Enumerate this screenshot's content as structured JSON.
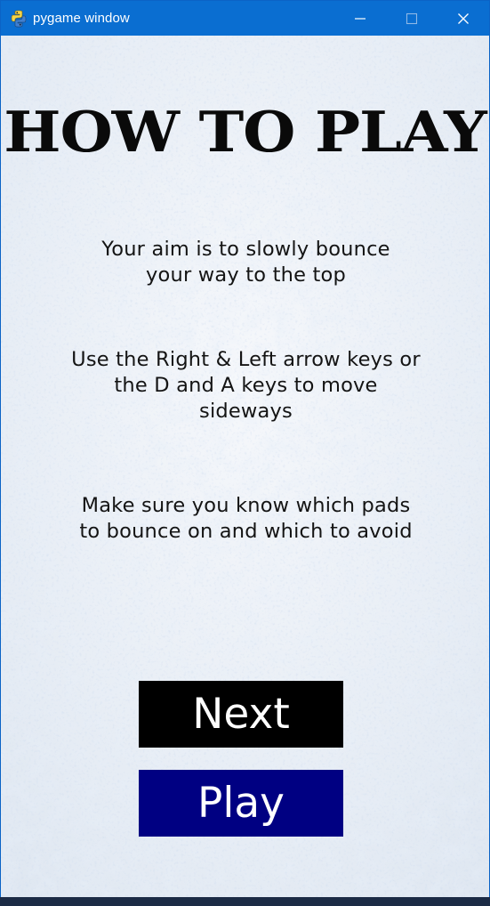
{
  "window": {
    "title": "pygame window",
    "accent_color": "#0a6ed1"
  },
  "icons": {
    "app": "python-snake-icon",
    "minimize": "minimize-icon",
    "maximize": "maximize-icon",
    "close": "close-icon"
  },
  "screen": {
    "heading": "HOW TO PLAY",
    "instructions": [
      {
        "lines": [
          "Your aim is to slowly bounce",
          "your way to the top"
        ]
      },
      {
        "lines": [
          "Use the Right & Left arrow keys or",
          "the D and A keys to move",
          "sideways"
        ]
      },
      {
        "lines": [
          "Make sure you know which pads",
          "to bounce on and which to avoid"
        ]
      }
    ],
    "buttons": {
      "next_label": "Next",
      "play_label": "Play",
      "next_color": "#000000",
      "play_color": "#000082"
    }
  }
}
